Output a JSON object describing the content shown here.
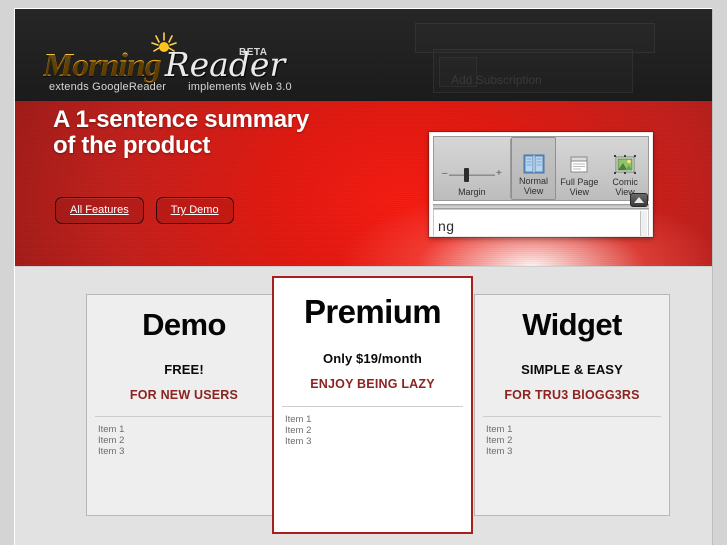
{
  "site": {
    "logo": {
      "word_primary": "Morning",
      "word_secondary": "Reader",
      "badge": "BETA",
      "tagline_left": "extends GoogleReader",
      "tagline_right": "implements Web 3.0",
      "icon": "sun-burst-icon",
      "primary_color": "#f4a306",
      "secondary_color": "#eaeaea"
    },
    "ghost_overlay_label": "Add Subscription"
  },
  "hero": {
    "headline": "A 1-sentence summary of the product",
    "background_color": "#d8201a",
    "buttons": [
      {
        "label": "All Features",
        "name": "all-features-button"
      },
      {
        "label": "Try Demo",
        "name": "try-demo-button"
      }
    ],
    "screenshot": {
      "ribbon": {
        "margin_group_label": "Margin",
        "slider_minus": "–",
        "slider_plus": "+",
        "views": [
          {
            "label_line1": "Normal",
            "label_line2": "View",
            "icon": "two-page-view-icon",
            "selected": true
          },
          {
            "label_line1": "Full Page",
            "label_line2": "View",
            "icon": "full-page-view-icon",
            "selected": false
          },
          {
            "label_line1": "Comic",
            "label_line2": "View",
            "icon": "comic-view-icon",
            "selected": false
          }
        ]
      },
      "body_text": "ng",
      "scroll_up_icon": "scroll-up-icon"
    }
  },
  "pricing": {
    "cards": [
      {
        "name": "demo",
        "title": "Demo",
        "price": "FREE!",
        "tagline": "FOR NEW USERS",
        "items": [
          "Item 1",
          "Item 2",
          "Item 3"
        ],
        "featured": false
      },
      {
        "name": "premium",
        "title": "Premium",
        "price": "Only $19/month",
        "tagline": "ENJOY BEING LAZY",
        "items": [
          "Item 1",
          "Item 2",
          "Item 3"
        ],
        "featured": true,
        "accent_color": "#a8201e"
      },
      {
        "name": "widget",
        "title": "Widget",
        "price": "SIMPLE & EASY",
        "tagline": "FOR TRU3 BlOGG3RS",
        "items": [
          "Item 1",
          "Item 2",
          "Item 3"
        ],
        "featured": false
      }
    ],
    "tagline_color": "#8c2321",
    "item_color": "#6e6e6e"
  }
}
